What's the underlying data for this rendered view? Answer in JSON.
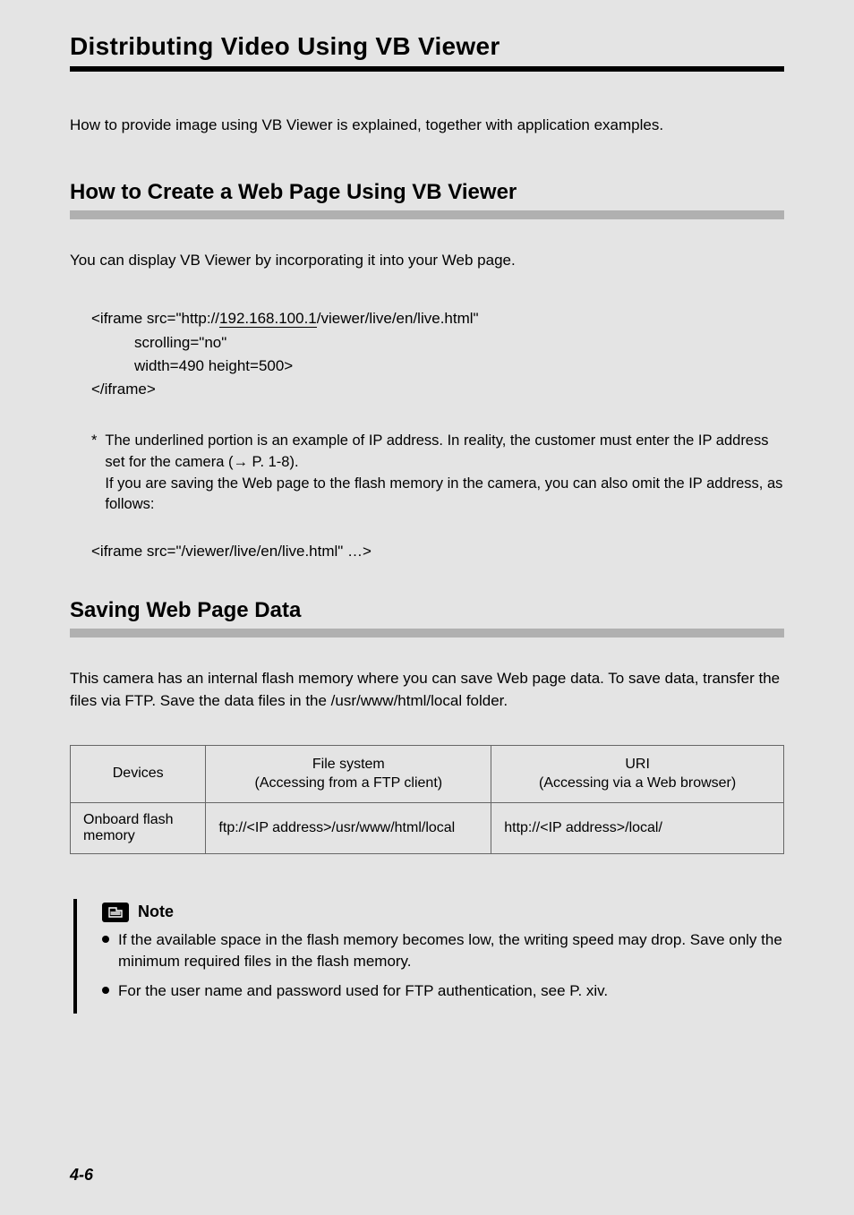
{
  "page": {
    "title": "Distributing Video Using VB Viewer",
    "intro": "How to provide image using VB Viewer is explained, together with application examples.",
    "page_number": "4-6"
  },
  "section1": {
    "heading": "How to Create a Web Page Using VB Viewer",
    "para": "You can display VB Viewer by incorporating it into your Web page.",
    "code": {
      "l1a": "<iframe src=\"http://",
      "l1_ip": "192.168.100.1",
      "l1b": "/viewer/live/en/live.html\"",
      "l2": "scrolling=\"no\"",
      "l3": "width=490 height=500>",
      "l4": "</iframe>"
    },
    "footnote": {
      "star": "*",
      "line1": "The underlined portion is an example of IP address. In reality, the customer must enter the IP address set for the camera (→ P. 1-8).",
      "line2": "If you are saving the Web page to the flash memory in the camera, you can also omit the IP address, as follows:"
    },
    "code_inline": "<iframe src=\"/viewer/live/en/live.html\" …>"
  },
  "section2": {
    "heading": "Saving Web Page Data",
    "para": "This camera has an internal flash memory where you can save Web page data. To save data, transfer the files via FTP. Save the data files in the /usr/www/html/local folder.",
    "table": {
      "headers": {
        "c1": "Devices",
        "c2a": "File system",
        "c2b": "(Accessing from a FTP client)",
        "c3a": "URI",
        "c3b": "(Accessing via a Web browser)"
      },
      "row1": {
        "c1": "Onboard flash memory",
        "c2": "ftp://<IP address>/usr/www/html/local",
        "c3": "http://<IP address>/local/"
      }
    }
  },
  "note": {
    "label": "Note",
    "items": [
      "If the available space in the flash memory becomes low, the writing speed may drop. Save only the minimum required files in the flash memory.",
      "For the user name and password used for FTP authentication, see P. xiv."
    ]
  }
}
